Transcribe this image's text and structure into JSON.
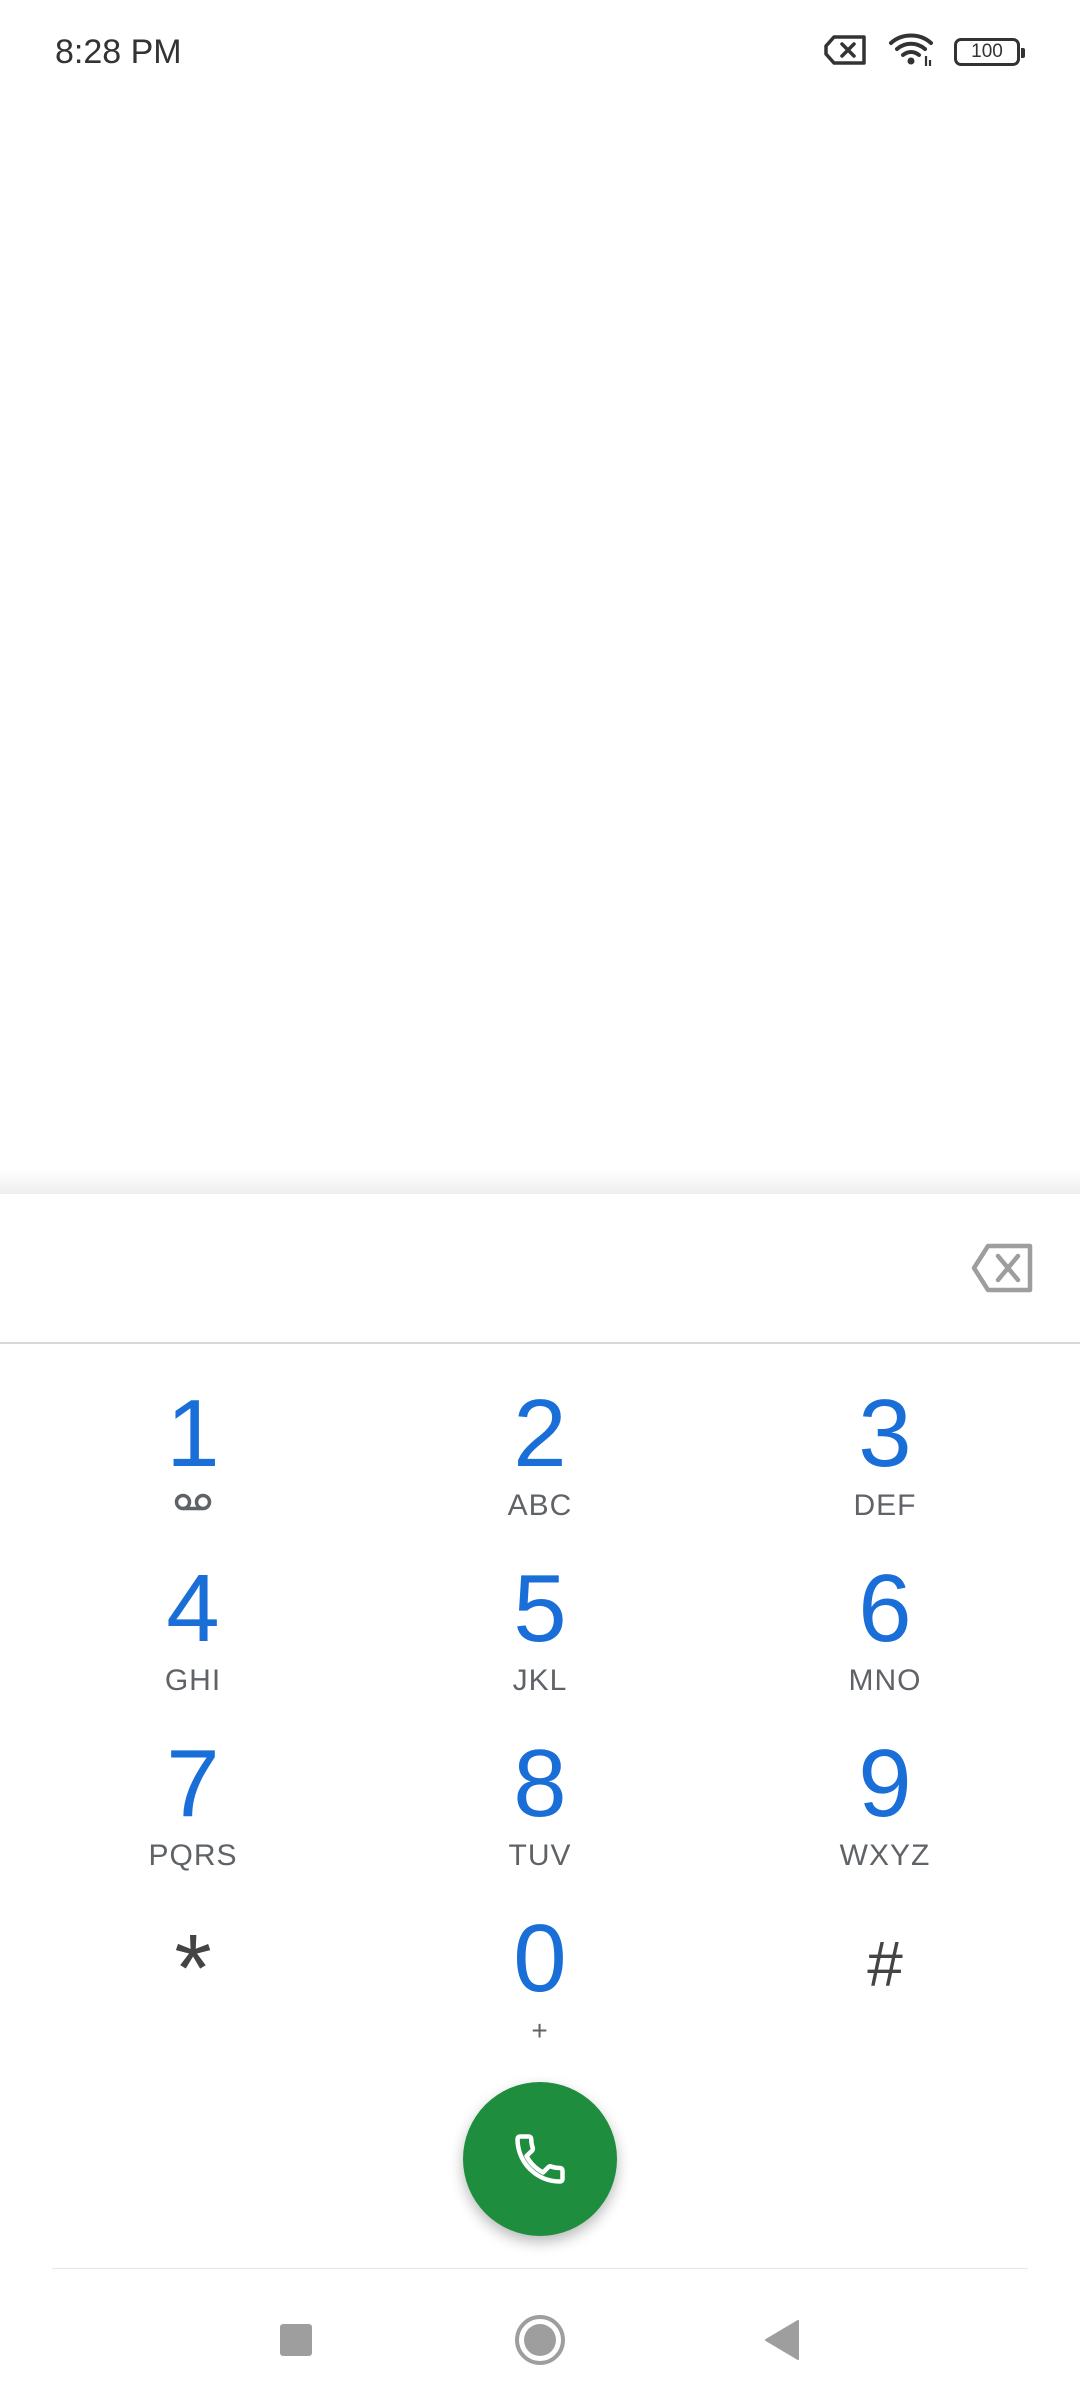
{
  "status_bar": {
    "time": "8:28 PM",
    "battery_level": "100",
    "icons": [
      "no-sim-icon",
      "wifi-icon",
      "battery-icon"
    ]
  },
  "dialer": {
    "digits_value": "",
    "keys": [
      {
        "digit": "1",
        "letters": "",
        "sub_icon": "voicemail-icon"
      },
      {
        "digit": "2",
        "letters": "ABC"
      },
      {
        "digit": "3",
        "letters": "DEF"
      },
      {
        "digit": "4",
        "letters": "GHI"
      },
      {
        "digit": "5",
        "letters": "JKL"
      },
      {
        "digit": "6",
        "letters": "MNO"
      },
      {
        "digit": "7",
        "letters": "PQRS"
      },
      {
        "digit": "8",
        "letters": "TUV"
      },
      {
        "digit": "9",
        "letters": "WXYZ"
      },
      {
        "digit": "*",
        "letters": ""
      },
      {
        "digit": "0",
        "letters": "+"
      },
      {
        "digit": "#",
        "letters": ""
      }
    ],
    "call_icon": "phone-icon",
    "backspace_icon": "backspace-icon"
  },
  "nav_bar": {
    "icons": [
      "recents-square-icon",
      "home-circle-icon",
      "back-triangle-icon"
    ]
  },
  "colors": {
    "digit_blue": "#1a6ed8",
    "call_green": "#1e8e3e",
    "letters_gray": "#5f6368"
  }
}
